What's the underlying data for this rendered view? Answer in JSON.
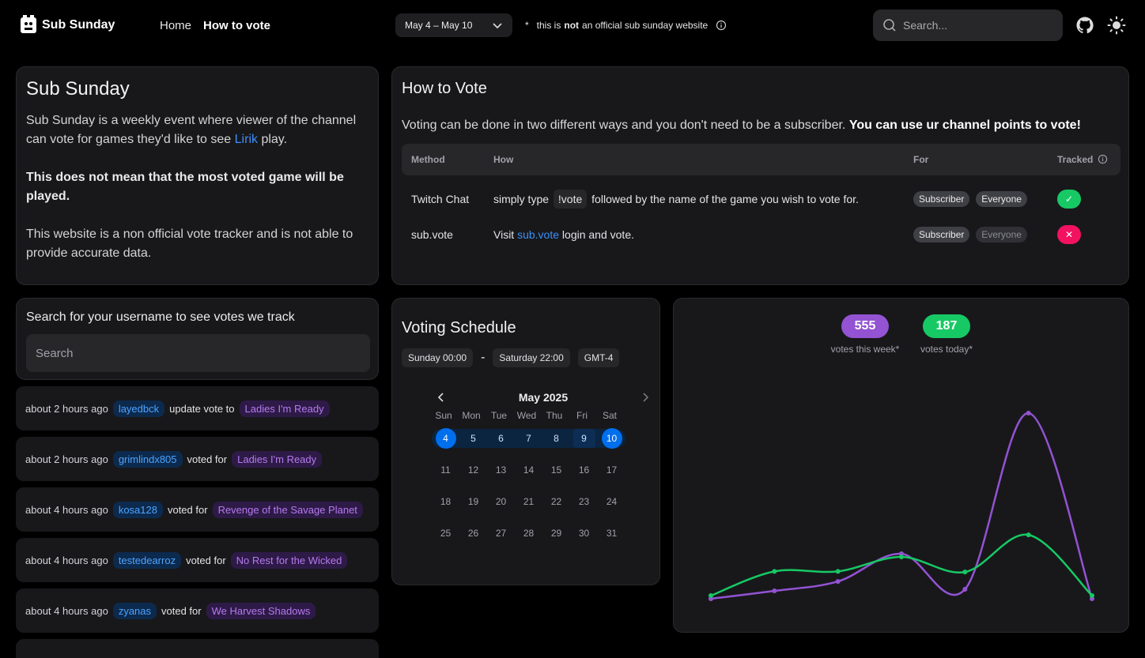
{
  "nav": {
    "brand": "Sub Sunday",
    "links": [
      "Home",
      "How to vote"
    ],
    "week": "May 4 – May 10",
    "disclaimer": {
      "pre": "this is",
      "bold": "not",
      "post": "an official sub sunday website"
    },
    "search_placeholder": "Search...",
    "icons": [
      "github-icon",
      "sun-icon",
      "info-icon",
      "chevron-down-icon"
    ]
  },
  "about": {
    "title": "Sub Sunday",
    "p1_pre": "Sub Sunday is a weekly event where viewer of the channel can vote for games they'd like to see",
    "p1_link": "Lirik",
    "p1_post": "play.",
    "p2": "This does not mean that the most voted game will be played.",
    "p3": "This website is a non official vote tracker and is not able to provide accurate data."
  },
  "howto": {
    "title": "How to Vote",
    "intro": "Voting can be done in two different ways and you don't need to be a subscriber.",
    "intro_bold": "You can use ur channel points to vote!",
    "headers": [
      "Method",
      "How",
      "For",
      "Tracked"
    ],
    "rows": [
      {
        "method": "Twitch Chat",
        "how_pre": "simply type",
        "how_code": "!vote",
        "how_post": "followed by the name of the game you wish to vote for.",
        "link": "",
        "for": [
          "Subscriber",
          "Everyone"
        ],
        "tracked": true
      },
      {
        "method": "sub.vote",
        "how_pre": "Visit",
        "how_code": "",
        "link": "sub.vote",
        "how_post": "login and vote.",
        "for": [
          "Subscriber",
          "Everyone"
        ],
        "tracked": false
      }
    ]
  },
  "user_search": {
    "label": "Search for your username to see votes we track",
    "placeholder": "Search"
  },
  "feed": [
    {
      "time": "about 2 hours ago",
      "user": "layedbck",
      "action": "update vote to",
      "game": "Ladies I'm Ready"
    },
    {
      "time": "about 2 hours ago",
      "user": "grimlindx805",
      "action": "voted for",
      "game": "Ladies I'm Ready"
    },
    {
      "time": "about 4 hours ago",
      "user": "kosa128",
      "action": "voted for",
      "game": "Revenge of the Savage Planet"
    },
    {
      "time": "about 4 hours ago",
      "user": "testedearroz",
      "action": "voted for",
      "game": "No Rest for the Wicked"
    },
    {
      "time": "about 4 hours ago",
      "user": "zyanas",
      "action": "voted for",
      "game": "We Harvest Shadows"
    }
  ],
  "schedule": {
    "title": "Voting Schedule",
    "start": "Sunday 00:00",
    "separator": "-",
    "end": "Saturday 22:00",
    "tz": "GMT-4",
    "month": "May 2025",
    "dow": [
      "Sun",
      "Mon",
      "Tue",
      "Wed",
      "Thu",
      "Fri",
      "Sat"
    ],
    "weeks": [
      [
        "4",
        "5",
        "6",
        "7",
        "8",
        "9",
        "10"
      ],
      [
        "11",
        "12",
        "13",
        "14",
        "15",
        "16",
        "17"
      ],
      [
        "18",
        "19",
        "20",
        "21",
        "22",
        "23",
        "24"
      ],
      [
        "25",
        "26",
        "27",
        "28",
        "29",
        "30",
        "31"
      ]
    ]
  },
  "stats": {
    "week_votes": "555",
    "week_label": "votes this week*",
    "today_votes": "187",
    "today_label": "votes today*",
    "colors": {
      "week": "#9353d3",
      "today": "#17c964"
    }
  },
  "chart_data": {
    "type": "line",
    "x": [
      1,
      2,
      3,
      4,
      5,
      6,
      7
    ],
    "series": [
      {
        "values": [
          5,
          30,
          60,
          148,
          35,
          595,
          5
        ]
      },
      {
        "values": [
          15,
          92,
          92,
          138,
          90,
          208,
          15
        ]
      }
    ],
    "ylim": [
      0,
      620
    ],
    "grid": false
  }
}
